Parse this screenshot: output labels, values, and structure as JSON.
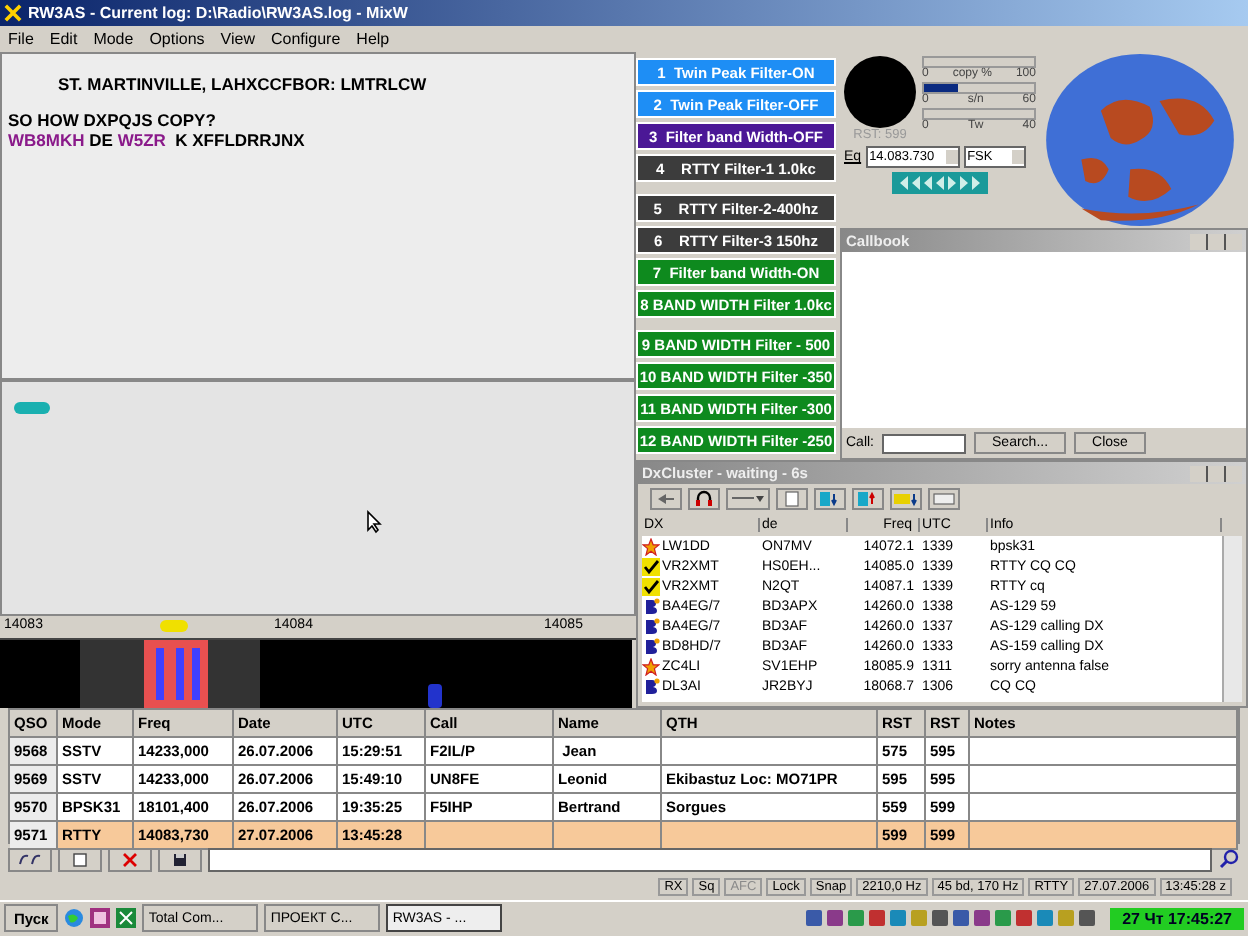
{
  "window": {
    "title": "RW3AS - Current log: D:\\Radio\\RW3AS.log - MixW"
  },
  "menu": [
    "File",
    "Edit",
    "Mode",
    "Options",
    "View",
    "Configure",
    "Help"
  ],
  "rx_text": [
    {
      "indent": true,
      "parts": [
        {
          "kind": "text",
          "text": "ST. MARTINVILLE, LAHXCCFBOR: LMTRLCW"
        }
      ]
    },
    {
      "indent": false,
      "parts": [
        {
          "kind": "text",
          "text": "SO HOW DXPQJS COPY?"
        }
      ]
    },
    {
      "indent": false,
      "parts": [
        {
          "kind": "call",
          "text": "WB8MKH"
        },
        {
          "kind": "text",
          "text": "DE"
        },
        {
          "kind": "call",
          "text": "W5ZR"
        },
        {
          "kind": "text",
          "text": " K XFFLDRRJNX"
        }
      ]
    }
  ],
  "waterfall": {
    "scale": [
      "14083",
      "14084",
      "14085"
    ]
  },
  "filter_groups": [
    {
      "buttons": [
        {
          "label": "1  Twin Peak Filter-ON",
          "color": "#1e8ef5"
        },
        {
          "label": "2  Twin Peak Filter-OFF",
          "color": "#1e8ef5"
        },
        {
          "label": "3  Filter band Width-OFF",
          "color": "#4b1896"
        },
        {
          "label": "4    RTTY Filter-1 1.0kc",
          "color": "#3c3c3c"
        }
      ]
    },
    {
      "buttons": [
        {
          "label": "5    RTTY Filter-2-400hz",
          "color": "#3c3c3c"
        },
        {
          "label": "6    RTTY Filter-3 150hz",
          "color": "#3c3c3c"
        },
        {
          "label": "7  Filter band Width-ON",
          "color": "#0e8a1e"
        },
        {
          "label": "8 BAND WIDTH Filter 1.0kc",
          "color": "#0e8a1e"
        }
      ]
    },
    {
      "buttons": [
        {
          "label": "9 BAND WIDTH Filter - 500",
          "color": "#0e8a1e"
        },
        {
          "label": "10 BAND WIDTH Filter -350",
          "color": "#0e8a1e"
        },
        {
          "label": "11 BAND WIDTH Filter -300",
          "color": "#0e8a1e"
        },
        {
          "label": "12 BAND WIDTH Filter -250",
          "color": "#0e8a1e"
        }
      ]
    }
  ],
  "indicators": {
    "rst": "RST: 599",
    "meters": [
      {
        "min": "0",
        "name": "copy %",
        "max": "100"
      },
      {
        "min": "0",
        "name": "s/n",
        "max": "60",
        "level": 0.3
      },
      {
        "min": "0",
        "name": "Tw",
        "max": "40"
      }
    ],
    "frequency_label": "Eq",
    "frequency": "14.083.730",
    "mode": "FSK"
  },
  "callbook": {
    "title": "Callbook",
    "call_label": "Call:",
    "search_button": "Search...",
    "close_button": "Close"
  },
  "dxcluster": {
    "title": "DxCluster - waiting - 6s",
    "columns": [
      "DX",
      "de",
      "Freq",
      "UTC",
      "Info"
    ],
    "rows": [
      {
        "kind": "spot",
        "cells": [
          "LW1DD",
          "ON7MV",
          "14072.1",
          "1339",
          "bpsk31"
        ]
      },
      {
        "kind": "check",
        "cells": [
          "VR2XMT",
          "HS0EH...",
          "14085.0",
          "1339",
          "RTTY CQ CQ"
        ]
      },
      {
        "kind": "check",
        "cells": [
          "VR2XMT",
          "N2QT",
          "14087.1",
          "1339",
          "RTTY cq"
        ]
      },
      {
        "kind": "beacon",
        "cells": [
          "BA4EG/7",
          "BD3APX",
          "14260.0",
          "1338",
          "AS-129  59"
        ]
      },
      {
        "kind": "beacon",
        "cells": [
          "BA4EG/7",
          "BD3AF",
          "14260.0",
          "1337",
          "AS-129 calling DX"
        ]
      },
      {
        "kind": "beacon",
        "cells": [
          "BD8HD/7",
          "BD3AF",
          "14260.0",
          "1333",
          "AS-159 calling DX"
        ]
      },
      {
        "kind": "spot",
        "cells": [
          "ZC4LI",
          "SV1EHP",
          "18085.9",
          "1311",
          "sorry antenna false"
        ]
      },
      {
        "kind": "beacon",
        "cells": [
          "DL3AI",
          "JR2BYJ",
          "18068.7",
          "1306",
          "CQ CQ"
        ]
      }
    ]
  },
  "log": {
    "columns": [
      "QSO",
      "Mode",
      "Freq",
      "Date",
      "UTC",
      "Call",
      "Name",
      "QTH",
      "RST",
      "RST",
      "Notes"
    ],
    "rows": [
      {
        "selected": false,
        "cells": [
          "9568",
          "SSTV",
          "14233,000",
          "26.07.2006",
          "15:29:51",
          "F2IL/P",
          " Jean",
          "",
          "575",
          "595",
          ""
        ]
      },
      {
        "selected": false,
        "cells": [
          "9569",
          "SSTV",
          "14233,000",
          "26.07.2006",
          "15:49:10",
          "UN8FE",
          "Leonid",
          "Ekibastuz Loc: MO71PR",
          "595",
          "595",
          ""
        ]
      },
      {
        "selected": false,
        "cells": [
          "9570",
          "BPSK31",
          "18101,400",
          "26.07.2006",
          "19:35:25",
          "F5IHP",
          "Bertrand",
          "Sorgues",
          "559",
          "599",
          ""
        ]
      },
      {
        "selected": true,
        "cells": [
          "9571",
          "RTTY",
          "14083,730",
          "27.07.2006",
          "13:45:28",
          "",
          "",
          "",
          "599",
          "599",
          ""
        ]
      }
    ]
  },
  "status_bar": [
    {
      "text": "RX",
      "disabled": false
    },
    {
      "text": "Sq",
      "disabled": false
    },
    {
      "text": "AFC",
      "disabled": true
    },
    {
      "text": "Lock",
      "disabled": false
    },
    {
      "text": "Snap",
      "disabled": false
    },
    {
      "text": "2210,0 Hz",
      "disabled": false
    },
    {
      "text": "45 bd, 170 Hz",
      "disabled": false
    },
    {
      "text": "RTTY",
      "disabled": false
    },
    {
      "text": "27.07.2006",
      "disabled": false
    },
    {
      "text": "13:45:28 z",
      "disabled": false
    }
  ],
  "taskbar": {
    "start": "Пуск",
    "tasks": [
      {
        "label": "Total Com...",
        "selected": false
      },
      {
        "label": "ПРОЕКТ С...",
        "selected": false
      },
      {
        "label": "RW3AS - ...",
        "selected": true
      }
    ],
    "clock": "27 Чт 17:45:27"
  }
}
